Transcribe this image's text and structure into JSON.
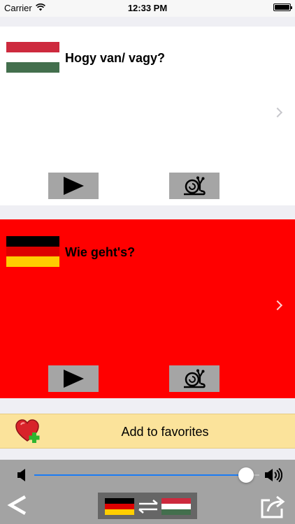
{
  "status_bar": {
    "carrier": "Carrier",
    "time": "12:33 PM"
  },
  "source_card": {
    "phrase": "Hogy van/ vagy?",
    "background": "#ffffff",
    "flag_icon": "hungary-flag-icon",
    "flag_colors": [
      "#cd2a3e",
      "#ffffff",
      "#436f4d"
    ]
  },
  "target_card": {
    "phrase": "Wie geht's?",
    "background": "#ff0000",
    "flag_icon": "germany-flag-icon",
    "flag_colors": [
      "#000000",
      "#dd0000",
      "#ffce00"
    ]
  },
  "favorites": {
    "label": "Add to favorites",
    "icon": "heart-plus-icon",
    "background": "#fbe39b"
  },
  "toolbar": {
    "volume_level": 0.94,
    "accent_color": "#1b7cf5",
    "back_label": "<",
    "language_pair_icon": "de-hu-swap-icon",
    "share_icon": "share-icon"
  }
}
